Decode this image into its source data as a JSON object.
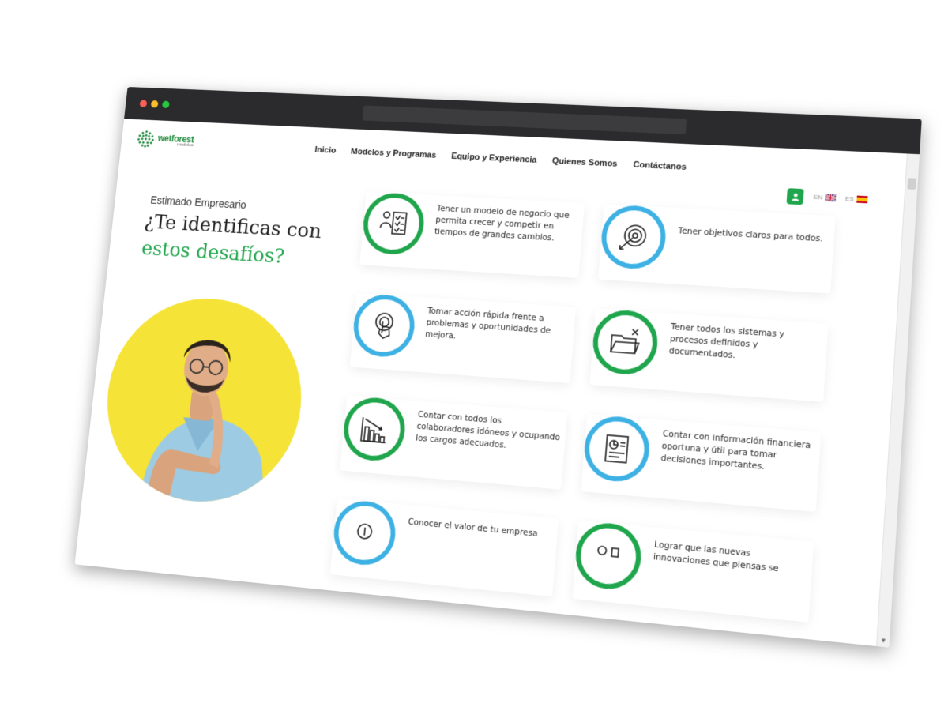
{
  "logo": {
    "name": "wetforest",
    "sub": "modelos"
  },
  "nav": [
    {
      "label": "Inicio"
    },
    {
      "label": "Modelos y Programas"
    },
    {
      "label": "Equipo y Experiencia"
    },
    {
      "label": "Quienes Somos"
    },
    {
      "label": "Contáctanos"
    }
  ],
  "languages": [
    {
      "code": "EN",
      "flag": "uk-flag-icon"
    },
    {
      "code": "ES",
      "flag": "spain-flag-icon"
    }
  ],
  "hero": {
    "eyebrow": "Estimado Empresario",
    "headline_line1": "¿Te identificas con",
    "headline_line2": "estos desafíos?"
  },
  "colors": {
    "accent_green": "#1fa54b",
    "accent_blue": "#3db1e3",
    "hero_yellow": "#f6e337",
    "titlebar": "#2b2b2d"
  },
  "challenges": [
    {
      "text": "Tener un modelo de negocio que permita crecer y competir en tiempos de grandes cambios.",
      "icon": "checklist-icon",
      "ring": "green"
    },
    {
      "text": "Tener objetivos claros para todos.",
      "icon": "target-icon",
      "ring": "blue"
    },
    {
      "text": "Tomar acción rápida frente a problemas y oportunidades de mejora.",
      "icon": "touch-target-icon",
      "ring": "blue"
    },
    {
      "text": "Tener todos los sistemas y procesos definidos y documentados.",
      "icon": "folder-icon",
      "ring": "green"
    },
    {
      "text": "Contar con todos los colaboradores idóneos y ocupando los cargos adecuados.",
      "icon": "bar-chart-icon",
      "ring": "green"
    },
    {
      "text": "Contar con información financiera oportuna y útil para tomar decisiones importantes.",
      "icon": "financial-report-icon",
      "ring": "blue"
    },
    {
      "text": "Conocer el valor de tu empresa",
      "icon": "valuation-icon",
      "ring": "blue"
    },
    {
      "text": "Lograr que las nuevas innovaciones que piensas se",
      "icon": "innovation-icon",
      "ring": "green"
    }
  ]
}
